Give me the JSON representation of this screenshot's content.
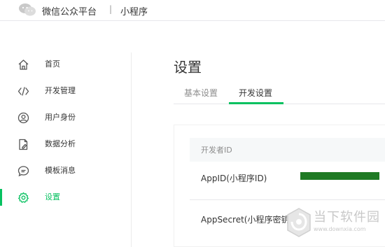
{
  "header": {
    "brand": "微信公众平台",
    "separator": "|",
    "subtitle": "小程序",
    "logo_icon": "wechat-logo-icon"
  },
  "sidebar": {
    "items": [
      {
        "label": "首页",
        "icon": "home-icon",
        "active": false
      },
      {
        "label": "开发管理",
        "icon": "code-icon",
        "active": false
      },
      {
        "label": "用户身份",
        "icon": "user-icon",
        "active": false
      },
      {
        "label": "数据分析",
        "icon": "document-edit-icon",
        "active": false
      },
      {
        "label": "模板消息",
        "icon": "chat-bubble-icon",
        "active": false
      },
      {
        "label": "设置",
        "icon": "gear-icon",
        "active": true
      }
    ]
  },
  "main": {
    "title": "设置",
    "tabs": [
      {
        "label": "基本设置",
        "active": false
      },
      {
        "label": "开发设置",
        "active": true
      }
    ],
    "panel": {
      "header": "开发者ID",
      "rows": [
        {
          "label": "AppID(小程序ID)",
          "value_redacted": true
        },
        {
          "label": "AppSecret(小程序密钥)"
        }
      ]
    }
  },
  "watermark": {
    "title": "当下软件园",
    "url": "www.downxia.com",
    "icon": "downxia-logo-icon"
  },
  "colors": {
    "accent": "#07c160",
    "redaction_bar": "#1f7a24",
    "text": "#353535",
    "muted": "#8d8d8d",
    "panel_header_bg": "#f6f8f9",
    "divider": "#e7e7eb"
  }
}
